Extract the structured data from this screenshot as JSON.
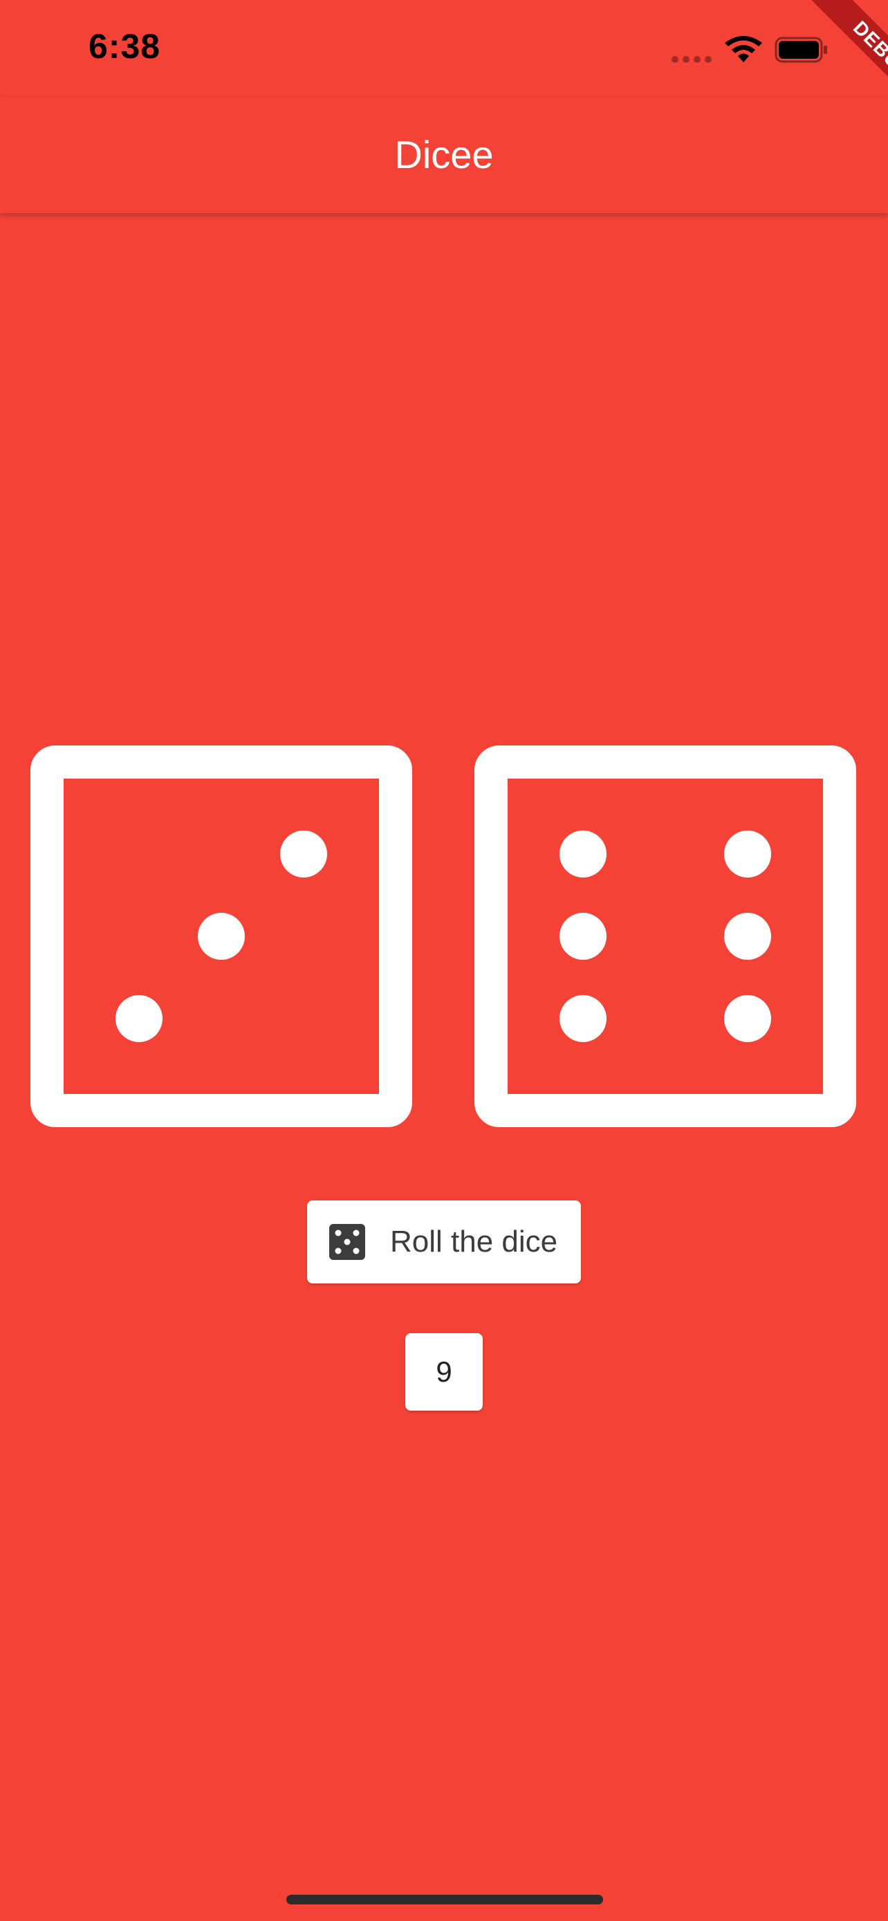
{
  "status_bar": {
    "time": "6:38",
    "icons": [
      "cellular-signal-icon",
      "wifi-icon",
      "battery-icon"
    ]
  },
  "app_bar": {
    "title": "Dicee"
  },
  "debug_banner": {
    "label": "DEBUG"
  },
  "dice": {
    "left_value": 3,
    "right_value": 6,
    "face_icon_names": [
      "dice-three-icon",
      "dice-six-icon"
    ]
  },
  "roll_button": {
    "label": "Roll the dice",
    "icon": "dice-five-icon"
  },
  "total": {
    "value": "9"
  },
  "colors": {
    "background": "#F44336",
    "foreground": "#FFFFFF",
    "button_text": "#3C3C3C",
    "debug_ribbon": "#B71C1C"
  }
}
